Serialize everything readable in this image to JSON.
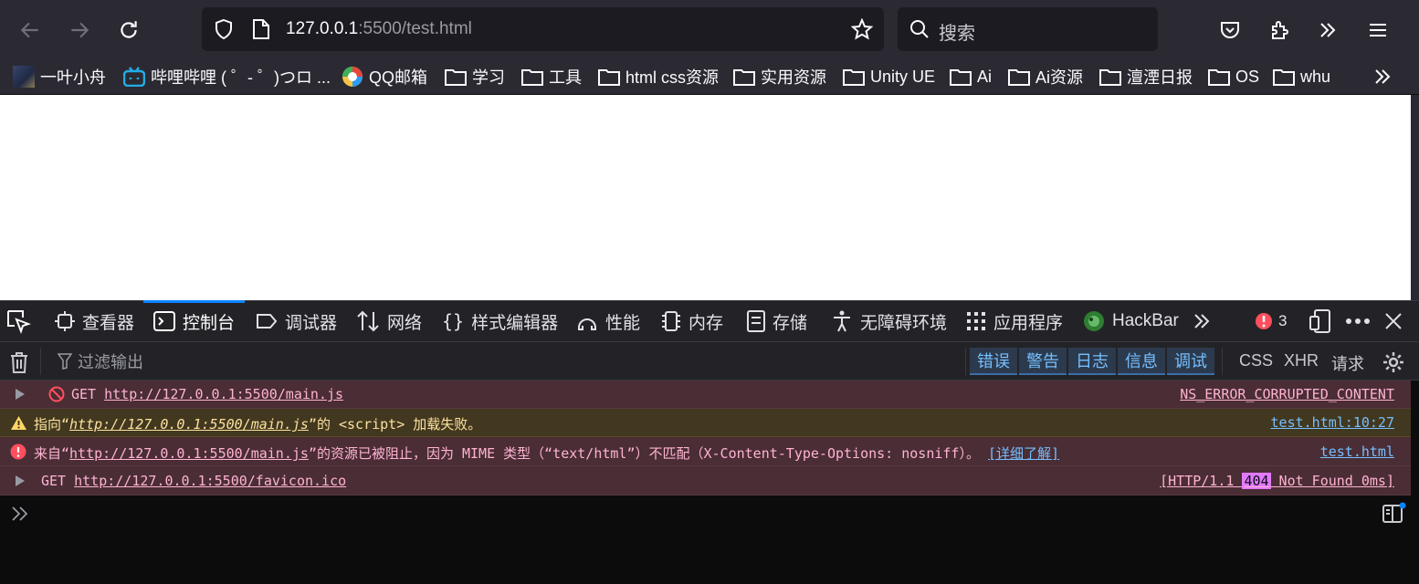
{
  "browser": {
    "url_host": "127.0.0.1",
    "url_path": ":5500/test.html",
    "search_placeholder": "搜索"
  },
  "bookmarks": [
    {
      "label": "一叶小舟",
      "icon": "profile-avatar-icon"
    },
    {
      "label": "哔哩哔哩 ( ゜- ゜)つロ ...",
      "icon": "bilibili-icon"
    },
    {
      "label": "QQ邮箱",
      "icon": "qqmail-icon"
    },
    {
      "label": "学习",
      "icon": "folder-icon"
    },
    {
      "label": "工具",
      "icon": "folder-icon"
    },
    {
      "label": "html css资源",
      "icon": "folder-icon"
    },
    {
      "label": "实用资源",
      "icon": "folder-icon"
    },
    {
      "label": "Unity UE",
      "icon": "folder-icon"
    },
    {
      "label": "Ai",
      "icon": "folder-icon"
    },
    {
      "label": "Ai资源",
      "icon": "folder-icon"
    },
    {
      "label": "澶湮日报",
      "icon": "folder-icon"
    },
    {
      "label": "OS",
      "icon": "folder-icon"
    },
    {
      "label": "whu",
      "icon": "folder-icon"
    }
  ],
  "devtools": {
    "tabs": [
      {
        "label": "查看器"
      },
      {
        "label": "控制台"
      },
      {
        "label": "调试器"
      },
      {
        "label": "网络"
      },
      {
        "label": "样式编辑器"
      },
      {
        "label": "性能"
      },
      {
        "label": "内存"
      },
      {
        "label": "存储"
      },
      {
        "label": "无障碍环境"
      },
      {
        "label": "应用程序"
      },
      {
        "label": "HackBar"
      }
    ],
    "error_count": "3",
    "filter_placeholder": "过滤输出",
    "level_buttons": [
      "错误",
      "警告",
      "日志",
      "信息",
      "调试"
    ],
    "type_buttons": [
      "CSS",
      "XHR",
      "请求"
    ],
    "messages": {
      "m1": {
        "method": "GET",
        "url": "http://127.0.0.1:5500/main.js",
        "right": "NS_ERROR_CORRUPTED_CONTENT"
      },
      "m2": {
        "pre": "指向“",
        "url": "http://127.0.0.1:5500/main.js",
        "post": "”的 <script> 加载失败。",
        "right": "test.html:10:27"
      },
      "m3": {
        "pre": "来自“",
        "url": "http://127.0.0.1:5500/main.js",
        "post": "”的资源已被阻止，因为 MIME 类型（“text/html”）不匹配（X-Content-Type-Options: nosniff）。",
        "learn": "[详细了解]",
        "right": "test.html"
      },
      "m4": {
        "method": "GET",
        "url": "http://127.0.0.1:5500/favicon.ico",
        "right_pre": "[HTTP/1.1 ",
        "status": "404",
        "right_post": " Not Found 0ms]"
      }
    }
  },
  "colors": {
    "accent": "#0a84ff",
    "error_bg": "#4a2d35",
    "warn_bg": "#42381f",
    "error_icon": "#ff4f5e",
    "warn_icon": "#ffd567"
  }
}
